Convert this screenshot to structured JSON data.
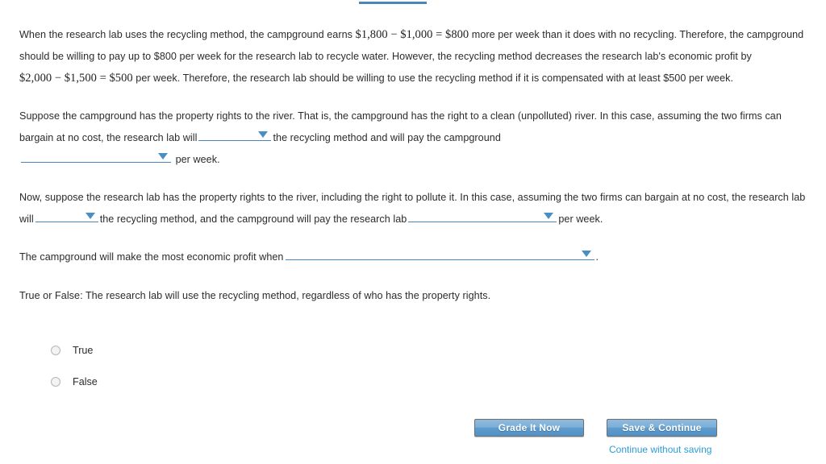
{
  "page": {
    "top_rule_color": "#4a86b8",
    "text_color": "#2b2b2b",
    "accent_color": "#4a86b8",
    "link_color": "#2e9bd6"
  },
  "paragraphs": {
    "p1": {
      "seg1": "When the research lab uses the recycling method, the campground earns ",
      "math1": "$1,800 − $1,000 = $800",
      "seg2": " more per week than it does with no recycling. Therefore, the campground should be willing to pay up to $800 per week for the research lab to recycle water. However, the recycling method decreases the research lab's economic profit by ",
      "math2": "$2,000 − $1,500 = $500",
      "seg3": " per week. Therefore, the research lab should be willing to use the recycling method if it is compensated with at least $500 per week."
    },
    "p2": {
      "seg1": "Suppose the campground has the property rights to the river. That is, the campground has the right to a clean (unpolluted) river. In this case, assuming the two firms can bargain at no cost, the research lab will",
      "seg2": "the recycling method and will pay the campground",
      "seg3": "per week."
    },
    "p3": {
      "seg1": "Now, suppose the research lab has the property rights to the river, including the right to pollute it. In this case, assuming the two firms can bargain at no cost, the research lab will",
      "seg2": "the recycling method, and the campground will pay the research lab",
      "seg3": "per"
    },
    "p3b": "week.",
    "p4": {
      "seg1": "The campground will make the most economic profit when",
      "seg2": "."
    },
    "p5": "True or False: The research lab will use the recycling method, regardless of who has the property rights."
  },
  "dropdowns": {
    "d1": {
      "value": "",
      "name": "use-or-not-dropdown-1"
    },
    "d2": {
      "value": "",
      "name": "amount-dropdown-1"
    },
    "d3": {
      "value": "",
      "name": "use-or-not-dropdown-2"
    },
    "d4": {
      "value": "",
      "name": "amount-dropdown-2"
    },
    "d5": {
      "value": "",
      "name": "most-profit-dropdown"
    }
  },
  "radios": [
    {
      "label": "True",
      "selected": false
    },
    {
      "label": "False",
      "selected": false
    }
  ],
  "actions": {
    "grade_label": "Grade It Now",
    "save_label": "Save & Continue",
    "continue_without_saving_label": "Continue without saving"
  }
}
